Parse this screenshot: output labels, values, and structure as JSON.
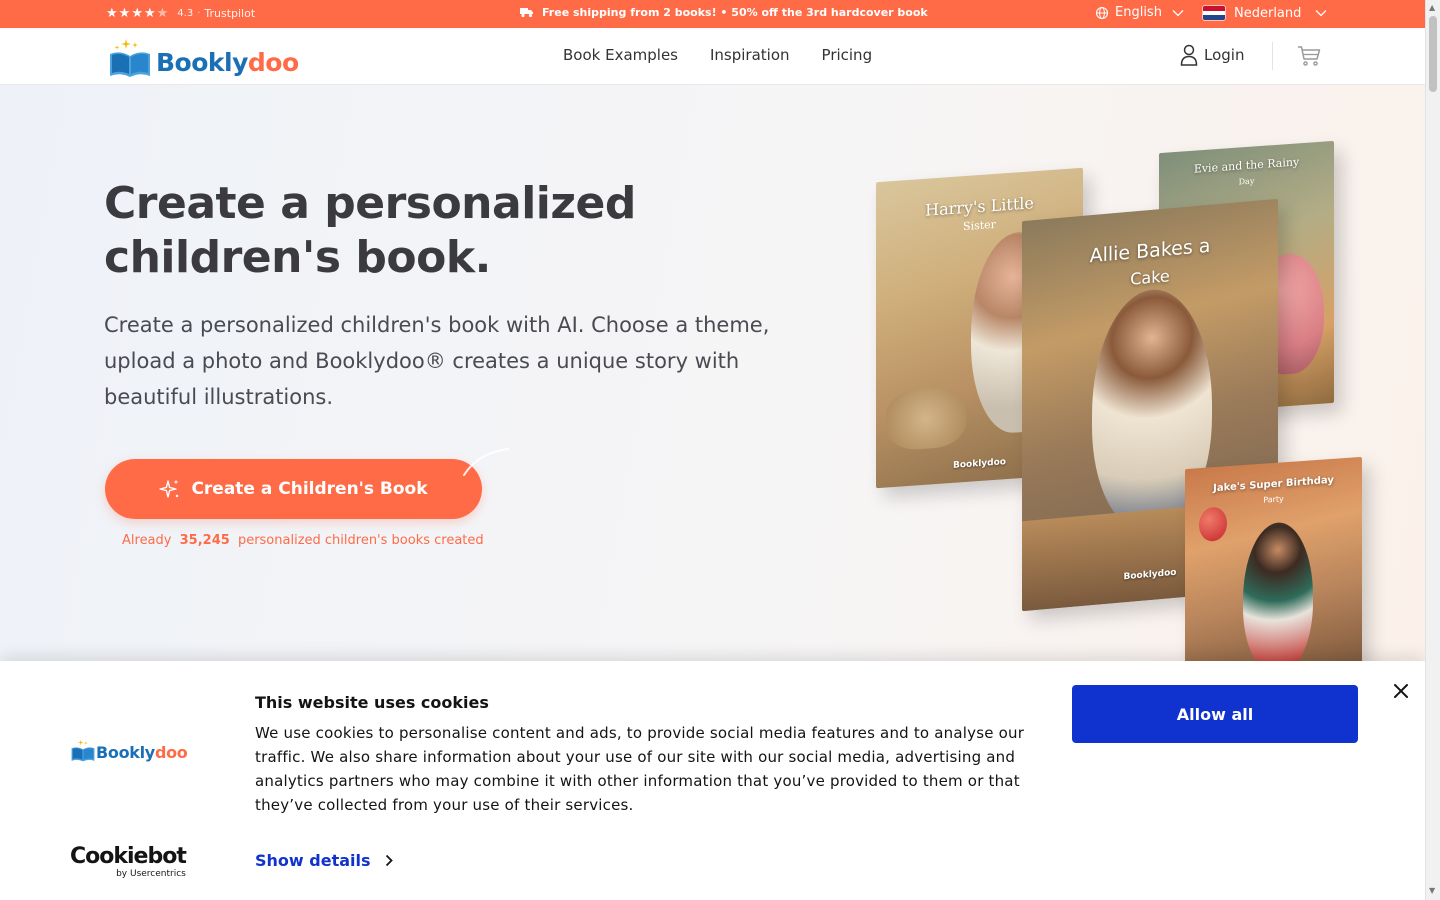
{
  "topbar": {
    "rating_score": "4.3",
    "separator": "·",
    "rating_source": "Trustpilot",
    "promo": "Free shipping from 2 books! • 50% off the 3rd hardcover book",
    "language": "English",
    "country": "Nederland",
    "stars_filled": 4,
    "stars_total": 5
  },
  "header": {
    "logo_part1": "Bookly",
    "logo_part2": "doo",
    "nav": [
      "Book Examples",
      "Inspiration",
      "Pricing"
    ],
    "login": "Login"
  },
  "hero": {
    "title": "Create a personalized children's book.",
    "lead": "Create a personalized children's book with AI. Choose a theme, upload a photo and Booklydoo® creates a unique story with beautiful illustrations.",
    "cta": "Create a Children's Book",
    "counter_prefix": "Already",
    "counter_value": "35,245",
    "counter_suffix": "personalized children's books created"
  },
  "books": [
    {
      "title": "Harry's Little",
      "subtitle": "Sister",
      "brand": "Booklydoo"
    },
    {
      "title": "Evie and the Rainy",
      "subtitle": "Day",
      "brand": ""
    },
    {
      "title": "Allie Bakes a",
      "subtitle": "Cake",
      "brand": "Booklydoo"
    },
    {
      "title": "Jake's Super Birthday",
      "subtitle": "Party",
      "brand": ""
    }
  ],
  "cookie": {
    "logo_part1": "Bookly",
    "logo_part2": "doo",
    "title": "This website uses cookies",
    "text": "We use cookies to personalise content and ads, to provide social media features and to analyse our traffic. We also share information about your use of our site with our social media, advertising and analytics partners who may combine it with other information that you’ve provided to them or that they’ve collected from your use of their services.",
    "show_details": "Show details",
    "allow_all": "Allow all",
    "provider": "Cookiebot",
    "provider_by": "by Usercentrics"
  },
  "colors": {
    "brand_orange": "#ff6b47",
    "brand_blue": "#1a6fb5",
    "cookie_blue": "#1032cf"
  }
}
